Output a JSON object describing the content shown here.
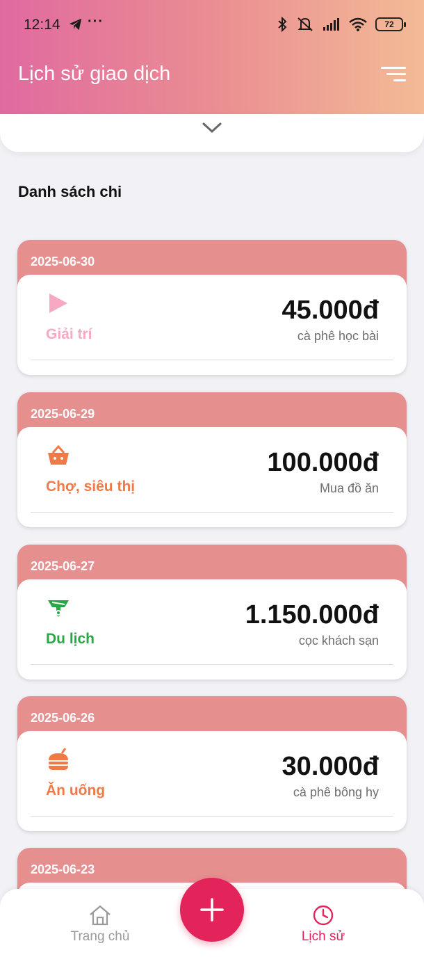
{
  "status_bar": {
    "time": "12:14",
    "dots": "···",
    "battery": "72",
    "icons": [
      "telegram-icon",
      "bluetooth-icon",
      "silent-icon",
      "signal-icon",
      "wifi-icon",
      "battery-icon"
    ]
  },
  "header": {
    "title": "Lịch sử giao dịch",
    "filter_icon": "filter-icon",
    "gradient": [
      "#e06aa0",
      "#f3bb96"
    ]
  },
  "section": {
    "title": "Danh sách chi"
  },
  "transactions": [
    {
      "date": "2025-06-30",
      "category": "Giải trí",
      "category_color": "#f7a9c4",
      "icon": "play-icon",
      "amount": "45.000đ",
      "note": "cà phê học bài"
    },
    {
      "date": "2025-06-29",
      "category": "Chợ, siêu thị",
      "category_color": "#f07a45",
      "icon": "basket-icon",
      "amount": "100.000đ",
      "note": "Mua đồ ăn"
    },
    {
      "date": "2025-06-27",
      "category": "Du lịch",
      "category_color": "#28a745",
      "icon": "travel-icon",
      "amount": "1.150.000đ",
      "note": "cọc khách sạn"
    },
    {
      "date": "2025-06-26",
      "category": "Ăn uống",
      "category_color": "#f07a45",
      "icon": "food-icon",
      "amount": "30.000đ",
      "note": "cà phê bông hy"
    },
    {
      "date": "2025-06-23"
    }
  ],
  "bottom_nav": {
    "home": {
      "label": "Trang chủ",
      "icon": "home-icon",
      "color": "#9a9a9a"
    },
    "add": {
      "icon": "plus-icon",
      "color": "#e2245a"
    },
    "history": {
      "label": "Lịch sử",
      "icon": "clock-icon",
      "color": "#e2245a",
      "active": true
    }
  }
}
